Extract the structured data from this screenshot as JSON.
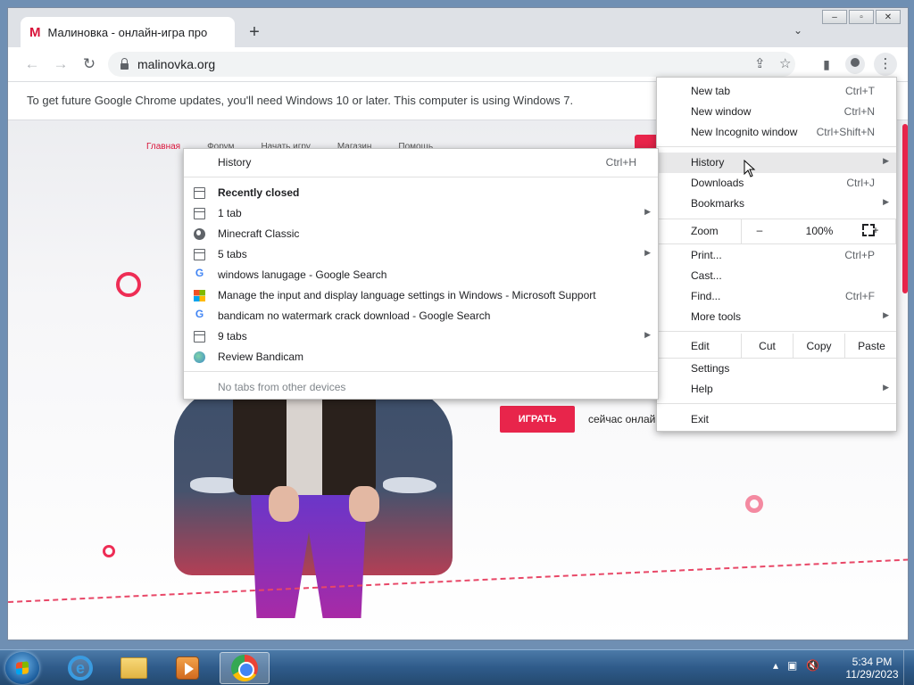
{
  "browser": {
    "tab": {
      "favicon": "М",
      "title": "Малиновка - онлайн-игра про "
    },
    "url": "malinovka.org",
    "infobar": "To get future Google Chrome updates, you'll need Windows 10 or later. This computer is using Windows 7.",
    "window_controls": {
      "minimize": "–",
      "maximize": "▫",
      "close": "✕"
    }
  },
  "site": {
    "nav": [
      "Главная",
      "Форум",
      "Начать игру",
      "Магазин",
      "Помощь"
    ],
    "play_button": "ИГРАТЬ",
    "online_text": "сейчас онлайн"
  },
  "chrome_menu": {
    "items_top": [
      {
        "label": "New tab",
        "shortcut": "Ctrl+T"
      },
      {
        "label": "New window",
        "shortcut": "Ctrl+N"
      },
      {
        "label": "New Incognito window",
        "shortcut": "Ctrl+Shift+N"
      }
    ],
    "items_mid": [
      {
        "label": "History",
        "shortcut": ""
      },
      {
        "label": "Downloads",
        "shortcut": "Ctrl+J"
      },
      {
        "label": "Bookmarks",
        "shortcut": ""
      }
    ],
    "zoom": {
      "label": "Zoom",
      "minus": "–",
      "value": "100%",
      "plus": "+"
    },
    "items_tools": [
      {
        "label": "Print...",
        "shortcut": "Ctrl+P"
      },
      {
        "label": "Cast...",
        "shortcut": ""
      },
      {
        "label": "Find...",
        "shortcut": "Ctrl+F"
      },
      {
        "label": "More tools",
        "shortcut": ""
      }
    ],
    "edit": {
      "label": "Edit",
      "cut": "Cut",
      "copy": "Copy",
      "paste": "Paste"
    },
    "items_settings": [
      {
        "label": "Settings"
      },
      {
        "label": "Help"
      }
    ],
    "exit": "Exit"
  },
  "history_menu": {
    "header": {
      "label": "History",
      "shortcut": "Ctrl+H"
    },
    "recently_closed": "Recently closed",
    "entries": [
      {
        "label": "1 tab",
        "icon": "window-icon",
        "submenu": true
      },
      {
        "label": "Minecraft Classic",
        "icon": "globe-icon",
        "submenu": false
      },
      {
        "label": "5 tabs",
        "icon": "window-icon",
        "submenu": true
      },
      {
        "label": "windows  lanugage - Google Search",
        "icon": "google-icon",
        "submenu": false
      },
      {
        "label": "Manage the input and display language settings in Windows - Microsoft Support",
        "icon": "microsoft-icon",
        "submenu": false
      },
      {
        "label": "bandicam no watermark crack download - Google Search",
        "icon": "google-icon",
        "submenu": false
      },
      {
        "label": "9 tabs",
        "icon": "window-icon",
        "submenu": true
      },
      {
        "label": "Review Bandicam",
        "icon": "bandicam-icon",
        "submenu": false
      }
    ],
    "footer": "No tabs from other devices"
  },
  "taskbar": {
    "clock_time": "5:34 PM",
    "clock_date": "11/29/2023"
  },
  "colors": {
    "accent_red": "#e8254b",
    "menu_highlight": "#e8e8e9"
  }
}
